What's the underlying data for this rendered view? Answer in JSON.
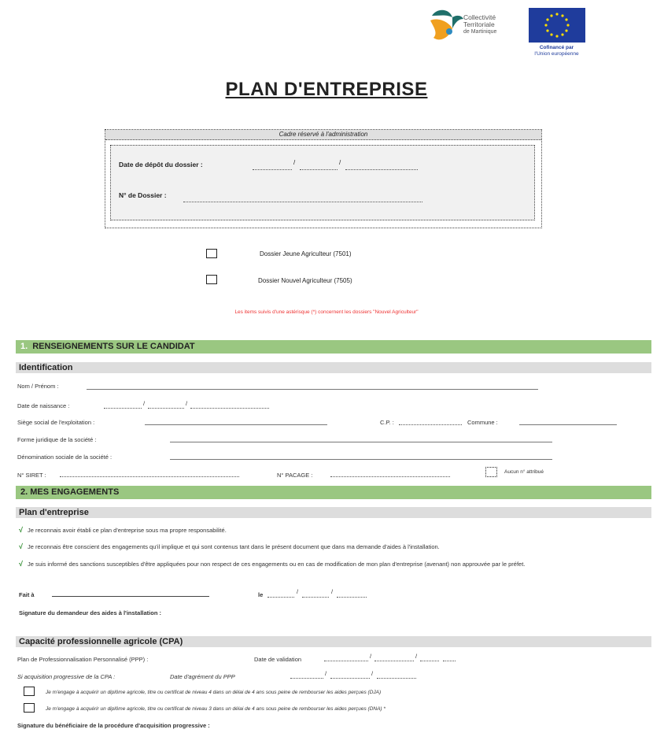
{
  "header": {
    "ctm_logo_text": [
      "Collectivité",
      "Territoriale",
      "de Martinique"
    ],
    "eu_caption": [
      "Cofinancé par",
      "l'Union européenne"
    ]
  },
  "title": "PLAN D'ENTREPRISE",
  "admin": {
    "box_title": "Cadre réservé à l'administration",
    "date_label": "Date de dépôt du dossier :",
    "dossier_label": "N° de Dossier :"
  },
  "dossier_types": [
    {
      "label": "Dossier Jeune Agriculteur (7501)"
    },
    {
      "label": "Dossier Nouvel Agriculteur (7505)"
    }
  ],
  "red_note": "Les items suivis d'une astérisque (*) concernent les dossiers \"Nouvel Agriculteur\"",
  "section1": {
    "number": "1.",
    "title": "RENSEIGNEMENTS SUR LE CANDIDAT",
    "subtitle": "Identification",
    "fields": {
      "nom": "Nom / Prénom :",
      "naissance": "Date de naissance :",
      "siege": "Siège social de l'exploitation :",
      "cp": "C.P. :",
      "commune": "Commune :",
      "forme": "Forme juridique de la société :",
      "denomination": "Dénomination sociale de la société :",
      "siret": "N° SIRET :",
      "pacage": "N° PACAGE :",
      "aucun": "Aucun n° attribué"
    }
  },
  "section2": {
    "title": "2. MES ENGAGEMENTS",
    "subtitle": "Plan d'entreprise",
    "check_symbol": "√",
    "commitments": [
      "Je reconnais avoir établi ce plan d'entreprise sous ma propre responsabilité.",
      "Je reconnais être conscient des engagements qu'il implique et qui sont contenus tant dans le présent document que dans ma demande d'aides à l'installation.",
      "Je suis informé des sanctions susceptibles d'être appliquées pour non respect de ces engagements ou en cas de modification de mon plan d'entreprise (avenant) non approuvée par le préfet."
    ],
    "fait_a": "Fait à",
    "le": "le",
    "signature_demandeur": "Signature du demandeur des aides à l'installation :"
  },
  "cpa": {
    "title": "Capacité professionnelle agricole (CPA)",
    "ppp_label": "Plan de Professionnalisation Personnalisé (PPP) :",
    "validation_label": "Date de validation",
    "acquisition_label": "Si acquisition progressive de la CPA :",
    "agrement_label": "Date d'agrément du PPP",
    "engagements": [
      "Je m'engage à acquérir un diplôme agricole, titre ou certificat de niveau 4 dans un délai de 4 ans sous peine de rembourser les aides perçues (DJA)",
      "Je m'engage à acquérir un diplôme agricole, titre ou certificat de niveau 3 dans un délai de 4 ans sous peine de rembourser les aides perçues (DNA) *"
    ],
    "signature_beneficiaire": "Signature du bénéficiaire de la procédure d'acquisition progressive :"
  },
  "colors": {
    "green_bar": "#9ac781",
    "grey_bar": "#dddddd",
    "red_note": "#ee3333",
    "eu_blue": "#1f3c9c",
    "eu_star": "#ffdd00"
  }
}
